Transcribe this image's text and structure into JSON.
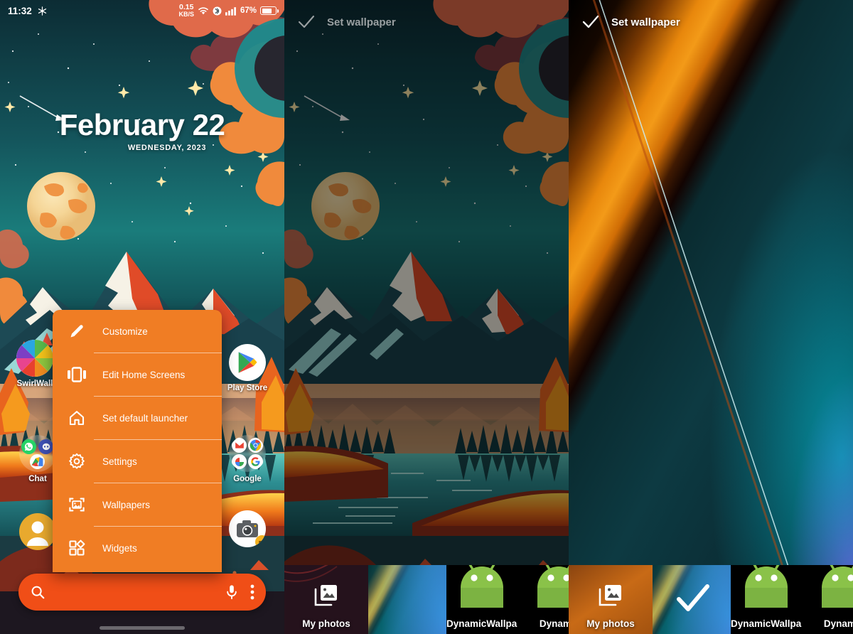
{
  "statusbar": {
    "time": "11:32",
    "weather_icon": "snowflake-icon",
    "network_speed_value": "0.15",
    "network_speed_unit": "KB/S",
    "wifi_icon": "wifi-icon",
    "bluetooth_icon": "bluetooth-icon",
    "signal_icon": "cellular-signal-icon",
    "battery_percent": "67%",
    "battery_icon": "battery-icon"
  },
  "home": {
    "clock_widget": {
      "date": "February 22",
      "weekday_year": "WEDNESDAY, 2023"
    },
    "icons": [
      {
        "name": "SwirlWall",
        "type": "app"
      },
      {
        "name": "Chat",
        "type": "folder"
      },
      {
        "name": "Play Store",
        "type": "app"
      },
      {
        "name": "Google",
        "type": "folder"
      },
      {
        "name": "",
        "type": "app-camera"
      },
      {
        "name": "",
        "type": "app-contacts"
      }
    ],
    "search": {
      "search_icon": "search-icon",
      "mic_icon": "microphone-icon",
      "overflow_icon": "more-vertical-icon",
      "placeholder": "",
      "value": ""
    }
  },
  "context_menu": {
    "items": [
      {
        "label": "Customize",
        "icon": "pencil-icon"
      },
      {
        "label": "Edit Home Screens",
        "icon": "home-screens-icon"
      },
      {
        "label": "Set default launcher",
        "icon": "house-icon"
      },
      {
        "label": "Settings",
        "icon": "gear-icon"
      },
      {
        "label": "Wallpapers",
        "icon": "image-frame-icon"
      },
      {
        "label": "Widgets",
        "icon": "widgets-grid-icon"
      }
    ]
  },
  "wallpaper_picker": {
    "header": {
      "title": "Set wallpaper",
      "check_icon": "check-icon"
    },
    "tray": {
      "my_photos_label": "My photos",
      "my_photos_icon": "photo-library-icon",
      "selected_check_icon": "check-icon",
      "items": [
        {
          "label": "DynamicWallpap..",
          "icon": "android-robot-icon"
        },
        {
          "label": "Dynamic",
          "icon": "android-robot-icon"
        }
      ]
    }
  },
  "wallpaper_selected": {
    "header": {
      "title": "Set wallpaper",
      "check_icon": "check-icon"
    },
    "tray": {
      "my_photos_label": "My photos",
      "my_photos_icon": "photo-library-icon",
      "selected_check_icon": "check-icon",
      "items": [
        {
          "label": "DynamicWallpap..",
          "icon": "android-robot-icon"
        },
        {
          "label": "Dynamic",
          "icon": "android-robot-icon"
        }
      ]
    }
  },
  "colors": {
    "menu_orange": "#f07d24",
    "search_orange": "#f04e17",
    "sky_teal": "#13565c",
    "accent_cyan": "#00e5ff",
    "accent_purple": "#aa28e6"
  }
}
